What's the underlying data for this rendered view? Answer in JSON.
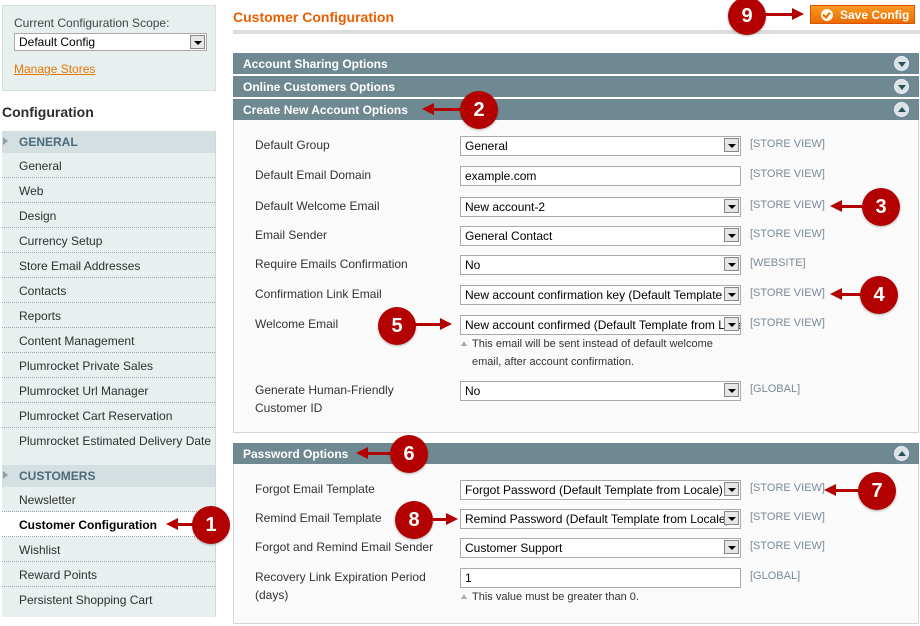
{
  "sidebar": {
    "scope_label": "Current Configuration Scope:",
    "scope_value": "Default Config",
    "manage_stores": "Manage Stores",
    "title": "Configuration",
    "groups": [
      {
        "label": "GENERAL",
        "items": [
          "General",
          "Web",
          "Design",
          "Currency Setup",
          "Store Email Addresses",
          "Contacts",
          "Reports",
          "Content Management",
          "Plumrocket Private Sales",
          "Plumrocket Url Manager",
          "Plumrocket Cart Reservation",
          "Plumrocket Estimated Delivery Date"
        ]
      },
      {
        "label": "CUSTOMERS",
        "items": [
          "Newsletter",
          "Customer Configuration",
          "Wishlist",
          "Reward Points",
          "Persistent Shopping Cart"
        ],
        "active": "Customer Configuration"
      }
    ]
  },
  "header": {
    "title": "Customer Configuration",
    "save_label": "Save Config"
  },
  "sections": {
    "account_sharing": {
      "title": "Account Sharing Options",
      "state": "collapsed"
    },
    "online_customers": {
      "title": "Online Customers Options",
      "state": "collapsed"
    },
    "create_account": {
      "title": "Create New Account Options",
      "state": "expanded",
      "fields": [
        {
          "label": "Default Group",
          "value": "General",
          "type": "select",
          "scope": "[STORE VIEW]"
        },
        {
          "label": "Default Email Domain",
          "value": "example.com",
          "type": "text",
          "scope": "[STORE VIEW]"
        },
        {
          "label": "Default Welcome Email",
          "value": "New account-2",
          "type": "select",
          "scope": "[STORE VIEW]"
        },
        {
          "label": "Email Sender",
          "value": "General Contact",
          "type": "select",
          "scope": "[STORE VIEW]"
        },
        {
          "label": "Require Emails Confirmation",
          "value": "No",
          "type": "select",
          "scope": "[WEBSITE]"
        },
        {
          "label": "Confirmation Link Email",
          "value": "New account confirmation key (Default Template from Locale)",
          "type": "select",
          "scope": "[STORE VIEW]"
        },
        {
          "label": "Welcome Email",
          "value": "New account confirmed (Default Template from Locale)",
          "type": "select",
          "scope": "[STORE VIEW]",
          "note_line1": "This email will be sent instead of default welcome",
          "note_line2": "email, after account confirmation."
        },
        {
          "label_line1": "Generate Human-Friendly",
          "label_line2": "Customer ID",
          "value": "No",
          "type": "select",
          "scope": "[GLOBAL]"
        }
      ]
    },
    "password": {
      "title": "Password Options",
      "state": "expanded",
      "fields": [
        {
          "label": "Forgot Email Template",
          "value": "Forgot Password (Default Template from Locale)",
          "type": "select",
          "scope": "[STORE VIEW]"
        },
        {
          "label": "Remind Email Template",
          "value": "Remind Password (Default Template from Locale)",
          "type": "select",
          "scope": "[STORE VIEW]"
        },
        {
          "label": "Forgot and Remind Email Sender",
          "value": "Customer Support",
          "type": "select",
          "scope": "[STORE VIEW]"
        },
        {
          "label_line1": "Recovery Link Expiration Period",
          "label_line2": "(days)",
          "value": "1",
          "type": "text",
          "scope": "[GLOBAL]",
          "note": "This value must be greater than 0."
        }
      ]
    }
  },
  "annotations": [
    "1",
    "2",
    "3",
    "4",
    "5",
    "6",
    "7",
    "8",
    "9"
  ],
  "colors": {
    "accent_orange": "#eb5e00",
    "section_header": "#6f8992",
    "badge_red": "#b30000"
  }
}
